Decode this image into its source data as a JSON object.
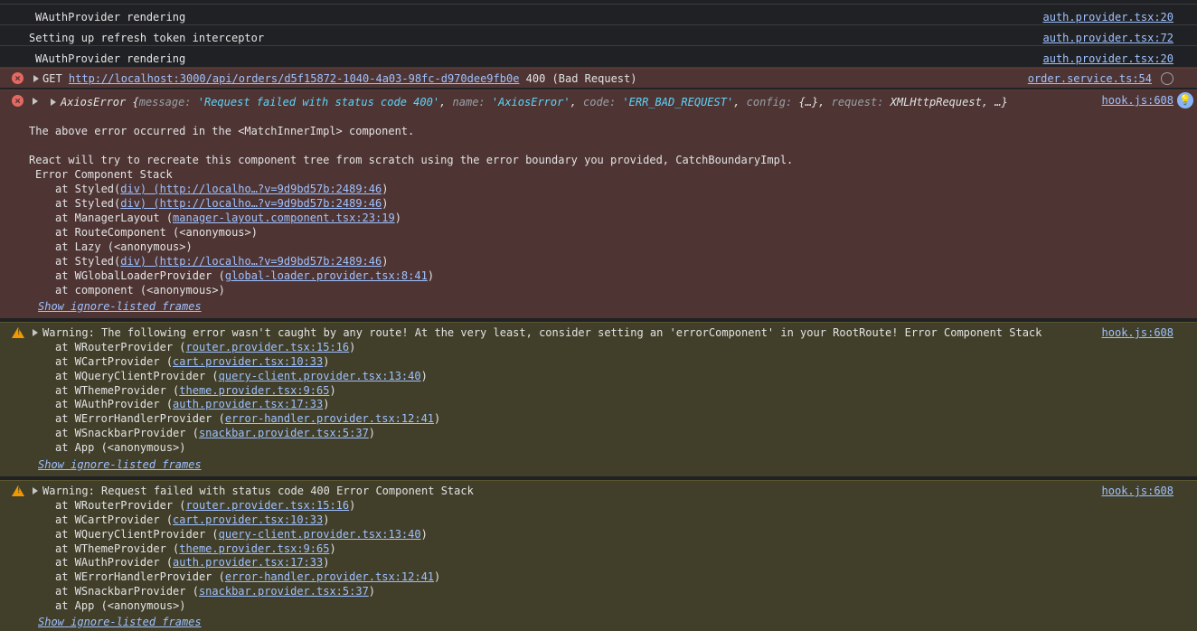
{
  "logs": [
    {
      "text": "WAuthProvider rendering",
      "source": "auth.provider.tsx:20"
    },
    {
      "text": "Setting up refresh token interceptor",
      "source": "auth.provider.tsx:72"
    },
    {
      "text": "WAuthProvider rendering",
      "source": "auth.provider.tsx:20"
    }
  ],
  "network_error": {
    "method": "GET",
    "url": "http://localhost:3000/api/orders/d5f15872-1040-4a03-98fc-d970dee9fb0e",
    "status": "400 (Bad Request)",
    "source": "order.service.ts:54"
  },
  "axios_error": {
    "name": "AxiosError",
    "open_brace": "{",
    "k_message": "message",
    "v_message": "'Request failed with status code 400'",
    "k_name": "name",
    "v_name": "'AxiosError'",
    "k_code": "code",
    "v_code": "'ERR_BAD_REQUEST'",
    "k_config": "config",
    "v_config": "{…}",
    "k_request": "request",
    "v_request": "XMLHttpRequest",
    "tail": ", …}",
    "source": "hook.js:608",
    "line1": "The above error occurred in the <MatchInnerImpl> component.",
    "line2": "React will try to recreate this component tree from scratch using the error boundary you provided, CatchBoundaryImpl.",
    "stack_title": "Error Component Stack",
    "stack": [
      {
        "pre": "at Styled(",
        "link": "div) (http://localho…?v=9d9bd57b:2489:46",
        "post": ")"
      },
      {
        "pre": "at Styled(",
        "link": "div) (http://localho…?v=9d9bd57b:2489:46",
        "post": ")"
      },
      {
        "pre": "at ManagerLayout (",
        "link": "manager-layout.component.tsx:23:19",
        "post": ")"
      },
      {
        "pre": "at RouteComponent (<anonymous>)",
        "link": "",
        "post": ""
      },
      {
        "pre": "at Lazy (<anonymous>)",
        "link": "",
        "post": ""
      },
      {
        "pre": "at Styled(",
        "link": "div) (http://localho…?v=9d9bd57b:2489:46",
        "post": ")"
      },
      {
        "pre": "at WGlobalLoaderProvider (",
        "link": "global-loader.provider.tsx:8:41",
        "post": ")"
      },
      {
        "pre": "at component (<anonymous>)",
        "link": "",
        "post": ""
      }
    ],
    "show_frames": "Show ignore-listed frames"
  },
  "warning1": {
    "text": "Warning: The following error wasn't caught by any route! At the very least, consider setting an 'errorComponent' in your RootRoute! Error Component Stack",
    "source": "hook.js:608",
    "stack": [
      {
        "pre": "at WRouterProvider (",
        "link": "router.provider.tsx:15:16",
        "post": ")"
      },
      {
        "pre": "at WCartProvider (",
        "link": "cart.provider.tsx:10:33",
        "post": ")"
      },
      {
        "pre": "at WQueryClientProvider (",
        "link": "query-client.provider.tsx:13:40",
        "post": ")"
      },
      {
        "pre": "at WThemeProvider (",
        "link": "theme.provider.tsx:9:65",
        "post": ")"
      },
      {
        "pre": "at WAuthProvider (",
        "link": "auth.provider.tsx:17:33",
        "post": ")"
      },
      {
        "pre": "at WErrorHandlerProvider (",
        "link": "error-handler.provider.tsx:12:41",
        "post": ")"
      },
      {
        "pre": "at WSnackbarProvider (",
        "link": "snackbar.provider.tsx:5:37",
        "post": ")"
      },
      {
        "pre": "at App (<anonymous>)",
        "link": "",
        "post": ""
      }
    ],
    "show_frames": "Show ignore-listed frames"
  },
  "warning2": {
    "text": "Warning: Request failed with status code 400 Error Component Stack",
    "source": "hook.js:608",
    "stack": [
      {
        "pre": "at WRouterProvider (",
        "link": "router.provider.tsx:15:16",
        "post": ")"
      },
      {
        "pre": "at WCartProvider (",
        "link": "cart.provider.tsx:10:33",
        "post": ")"
      },
      {
        "pre": "at WQueryClientProvider (",
        "link": "query-client.provider.tsx:13:40",
        "post": ")"
      },
      {
        "pre": "at WThemeProvider (",
        "link": "theme.provider.tsx:9:65",
        "post": ")"
      },
      {
        "pre": "at WAuthProvider (",
        "link": "auth.provider.tsx:17:33",
        "post": ")"
      },
      {
        "pre": "at WErrorHandlerProvider (",
        "link": "error-handler.provider.tsx:12:41",
        "post": ")"
      },
      {
        "pre": "at WSnackbarProvider (",
        "link": "snackbar.provider.tsx:5:37",
        "post": ")"
      },
      {
        "pre": "at App (<anonymous>)",
        "link": "",
        "post": ""
      }
    ],
    "show_frames": "Show ignore-listed frames"
  },
  "colors": {
    "background": "#202124",
    "error_bg": "#4e3534",
    "warning_bg": "#413f2a",
    "link": "#9fc1ff",
    "string": "#5cd5fb"
  },
  "icons": {
    "error": "error-circle-icon",
    "warning": "warning-triangle-icon",
    "expand": "expand-triangle-icon",
    "ai_assist": "lightbulb-icon",
    "network": "network-request-icon"
  }
}
